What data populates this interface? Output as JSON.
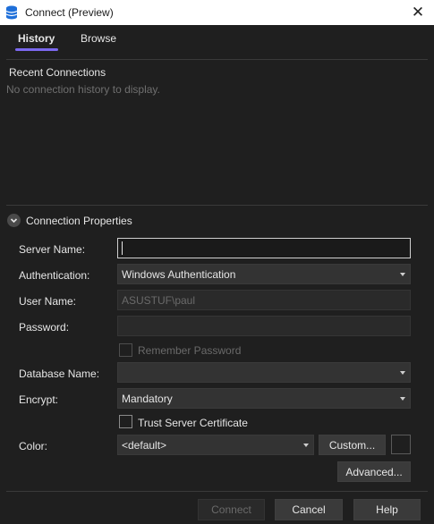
{
  "window": {
    "title": "Connect (Preview)",
    "app_icon": "database-icon",
    "close_icon": "close-icon",
    "close_glyph": "✕"
  },
  "tabs": [
    {
      "label": "History",
      "active": true
    },
    {
      "label": "Browse",
      "active": false
    }
  ],
  "history": {
    "title": "Recent Connections",
    "empty_text": "No connection history to display."
  },
  "connection_properties": {
    "title": "Connection Properties",
    "toggle_icon": "chevron-down-icon",
    "server_name": {
      "label": "Server Name:",
      "value": ""
    },
    "authentication": {
      "label": "Authentication:",
      "value": "Windows Authentication"
    },
    "user_name": {
      "label": "User Name:",
      "value": "ASUSTUF\\paul"
    },
    "password": {
      "label": "Password:",
      "value": ""
    },
    "remember_password": {
      "label": "Remember Password",
      "checked": false
    },
    "database_name": {
      "label": "Database Name:",
      "value": ""
    },
    "encrypt": {
      "label": "Encrypt:",
      "value": "Mandatory"
    },
    "trust_server_certificate": {
      "label": "Trust Server Certificate",
      "checked": false
    },
    "color": {
      "label": "Color:",
      "value": "<default>",
      "custom_button": "Custom..."
    },
    "advanced_button": "Advanced..."
  },
  "footer": {
    "connect": "Connect",
    "cancel": "Cancel",
    "help": "Help"
  },
  "colors": {
    "background": "#1f1f1f",
    "accent": "#7b68ee",
    "button": "#3a3a3a",
    "disabled_text": "#6a6a6a"
  }
}
